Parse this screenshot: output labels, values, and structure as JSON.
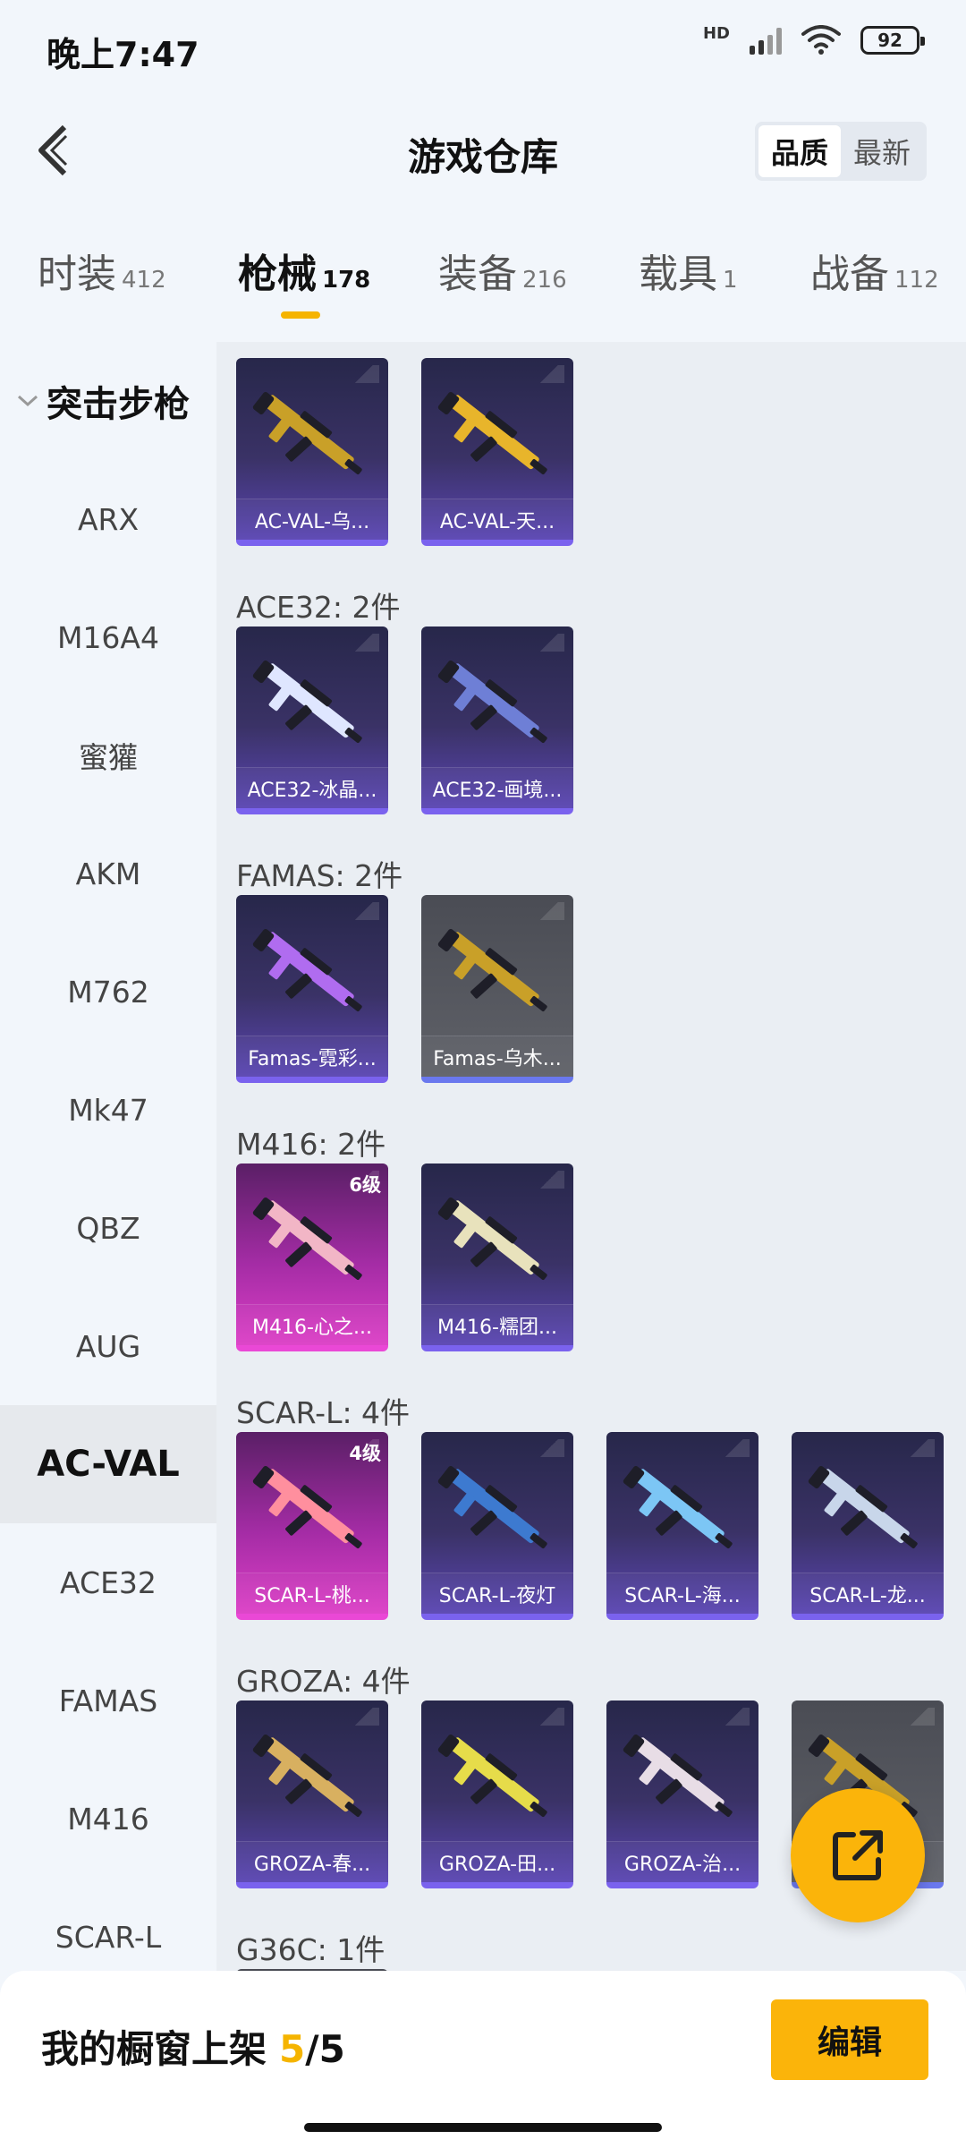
{
  "status": {
    "time": "晚上7:47",
    "hd": "HD",
    "battery": "92"
  },
  "header": {
    "title": "游戏仓库",
    "sort_options": [
      "品质",
      "最新"
    ]
  },
  "category_tabs": [
    {
      "label": "时装",
      "count": "412"
    },
    {
      "label": "枪械",
      "count": "178"
    },
    {
      "label": "装备",
      "count": "216"
    },
    {
      "label": "载具",
      "count": "1"
    },
    {
      "label": "战备",
      "count": "112"
    }
  ],
  "sidebar": {
    "group": "突击步枪",
    "items": [
      "ARX",
      "M16A4",
      "蜜獾",
      "AKM",
      "M762",
      "Mk47",
      "QBZ",
      "AUG",
      "AC-VAL",
      "ACE32",
      "FAMAS",
      "M416",
      "SCAR-L"
    ]
  },
  "sections": [
    {
      "title": "",
      "items": [
        {
          "name": "AC-VAL-乌...",
          "rarity": "purple",
          "gun_color": "#c9a028"
        },
        {
          "name": "AC-VAL-天...",
          "rarity": "purple",
          "gun_color": "#e8b52b"
        }
      ]
    },
    {
      "title": "ACE32: 2件",
      "items": [
        {
          "name": "ACE32-冰晶...",
          "rarity": "purple",
          "gun_color": "#dfe6ff"
        },
        {
          "name": "ACE32-画境...",
          "rarity": "purple",
          "gun_color": "#6e7fd6"
        }
      ]
    },
    {
      "title": "FAMAS: 2件",
      "items": [
        {
          "name": "Famas-霓彩...",
          "rarity": "purple",
          "gun_color": "#b06cf0"
        },
        {
          "name": "Famas-乌木...",
          "rarity": "gray",
          "gun_color": "#c9a028"
        }
      ]
    },
    {
      "title": "M416: 2件",
      "items": [
        {
          "name": "M416-心之...",
          "rarity": "pink",
          "gun_color": "#f2b6c6",
          "level": "6级"
        },
        {
          "name": "M416-糯团...",
          "rarity": "purple",
          "gun_color": "#e8e2bc"
        }
      ]
    },
    {
      "title": "SCAR-L: 4件",
      "items": [
        {
          "name": "SCAR-L-桃...",
          "rarity": "pink",
          "gun_color": "#ff8f9e",
          "level": "4级"
        },
        {
          "name": "SCAR-L-夜灯",
          "rarity": "purple",
          "gun_color": "#3d7ad0"
        },
        {
          "name": "SCAR-L-海...",
          "rarity": "purple",
          "gun_color": "#7cc6f5"
        },
        {
          "name": "SCAR-L-龙...",
          "rarity": "purple",
          "gun_color": "#c8d6ea"
        }
      ]
    },
    {
      "title": "GROZA: 4件",
      "items": [
        {
          "name": "GROZA-春...",
          "rarity": "purple",
          "gun_color": "#d8b060"
        },
        {
          "name": "GROZA-田...",
          "rarity": "purple",
          "gun_color": "#e6dc4a"
        },
        {
          "name": "GROZA-治...",
          "rarity": "purple",
          "gun_color": "#e8dde6"
        },
        {
          "name": "",
          "rarity": "gray",
          "gun_color": "#c9a028"
        }
      ]
    },
    {
      "title": "G36C: 1件",
      "items": [
        {
          "name": "",
          "rarity": "gray",
          "gun_color": "#777"
        }
      ]
    }
  ],
  "bottom": {
    "label": "我的橱窗上架",
    "current": "5",
    "total": "/5",
    "edit_label": "编辑"
  },
  "icons": {
    "back": "back-arrow-icon",
    "share": "share-external-icon"
  },
  "colors": {
    "accent": "#f5b400",
    "purple_rarity": "#7a62ee",
    "pink_rarity": "#ea48d6"
  }
}
